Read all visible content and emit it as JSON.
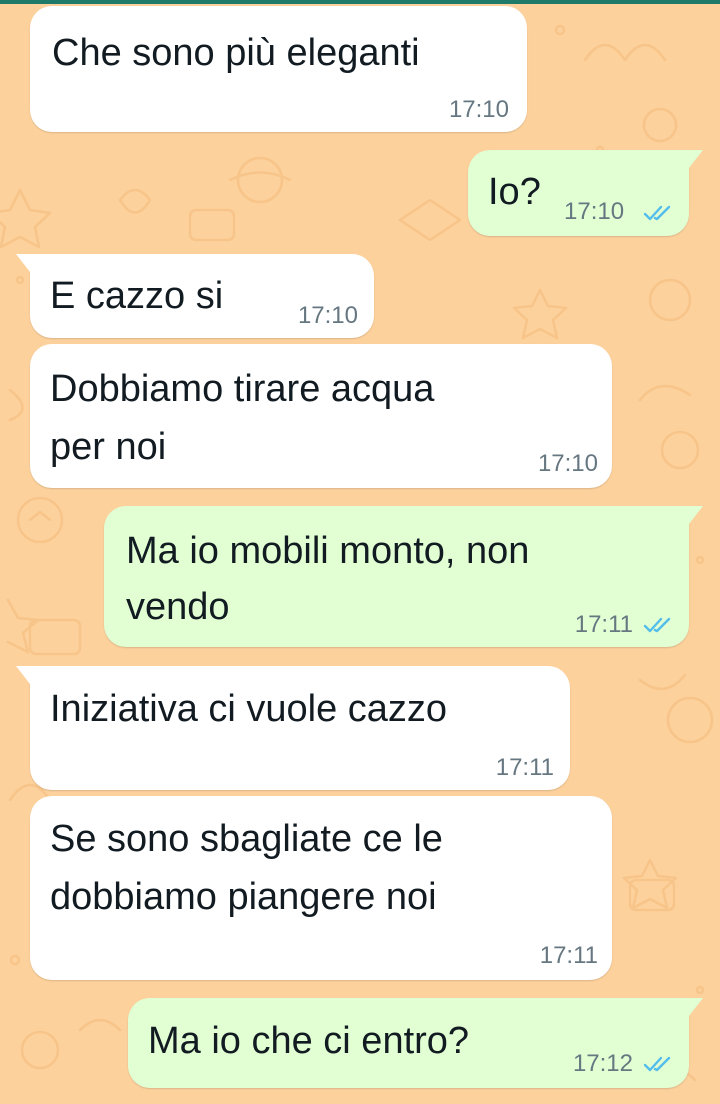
{
  "colors": {
    "wallpaper": "#fdd19c",
    "incoming_bubble": "#ffffff",
    "outgoing_bubble": "#e2ffd4",
    "text": "#111b21",
    "timestamp": "#667781",
    "read_ticks": "#53bdeb",
    "top_bar": "#1f7a6a"
  },
  "messages": [
    {
      "direction": "incoming",
      "lines": [
        "Che sono più eleganti"
      ],
      "time": "17:10"
    },
    {
      "direction": "outgoing",
      "lines": [
        "Io?"
      ],
      "time": "17:10",
      "status": "read"
    },
    {
      "direction": "incoming",
      "lines": [
        "E cazzo si"
      ],
      "time": "17:10"
    },
    {
      "direction": "incoming",
      "lines": [
        "Dobbiamo tirare acqua",
        "per noi"
      ],
      "time": "17:10"
    },
    {
      "direction": "outgoing",
      "lines": [
        "Ma io mobili monto, non",
        "vendo"
      ],
      "time": "17:11",
      "status": "read"
    },
    {
      "direction": "incoming",
      "lines": [
        "Iniziativa ci vuole cazzo"
      ],
      "time": "17:11"
    },
    {
      "direction": "incoming",
      "lines": [
        "Se sono sbagliate ce le",
        "dobbiamo piangere noi"
      ],
      "time": "17:11"
    },
    {
      "direction": "outgoing",
      "lines": [
        "Ma io che ci entro?"
      ],
      "time": "17:12",
      "status": "read"
    }
  ]
}
